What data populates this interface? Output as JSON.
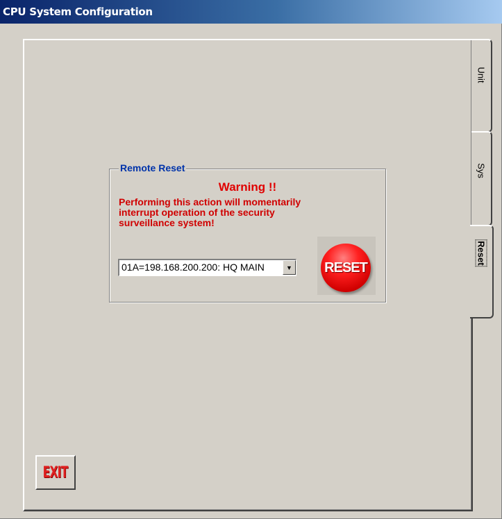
{
  "window": {
    "title": "CPU System Configuration"
  },
  "tabs": [
    {
      "label": "Unit",
      "active": false
    },
    {
      "label": "Sys",
      "active": false
    },
    {
      "label": "Reset",
      "active": true
    }
  ],
  "remote_reset": {
    "group_label": "Remote Reset",
    "warning_title": "Warning !!",
    "warning_line1": "Performing this action will momentarily",
    "warning_line2": "interrupt operation of the security",
    "warning_line3": "surveillance system!",
    "unit_select": {
      "selected": "01A=198.168.200.200: HQ MAIN"
    },
    "reset_button_label": "RESET"
  },
  "exit_button_label": "EXIT",
  "colors": {
    "warning": "#e00000",
    "group_label": "#0033aa",
    "reset_button": "#ff2020",
    "panel_bg": "#d4d0c8"
  }
}
